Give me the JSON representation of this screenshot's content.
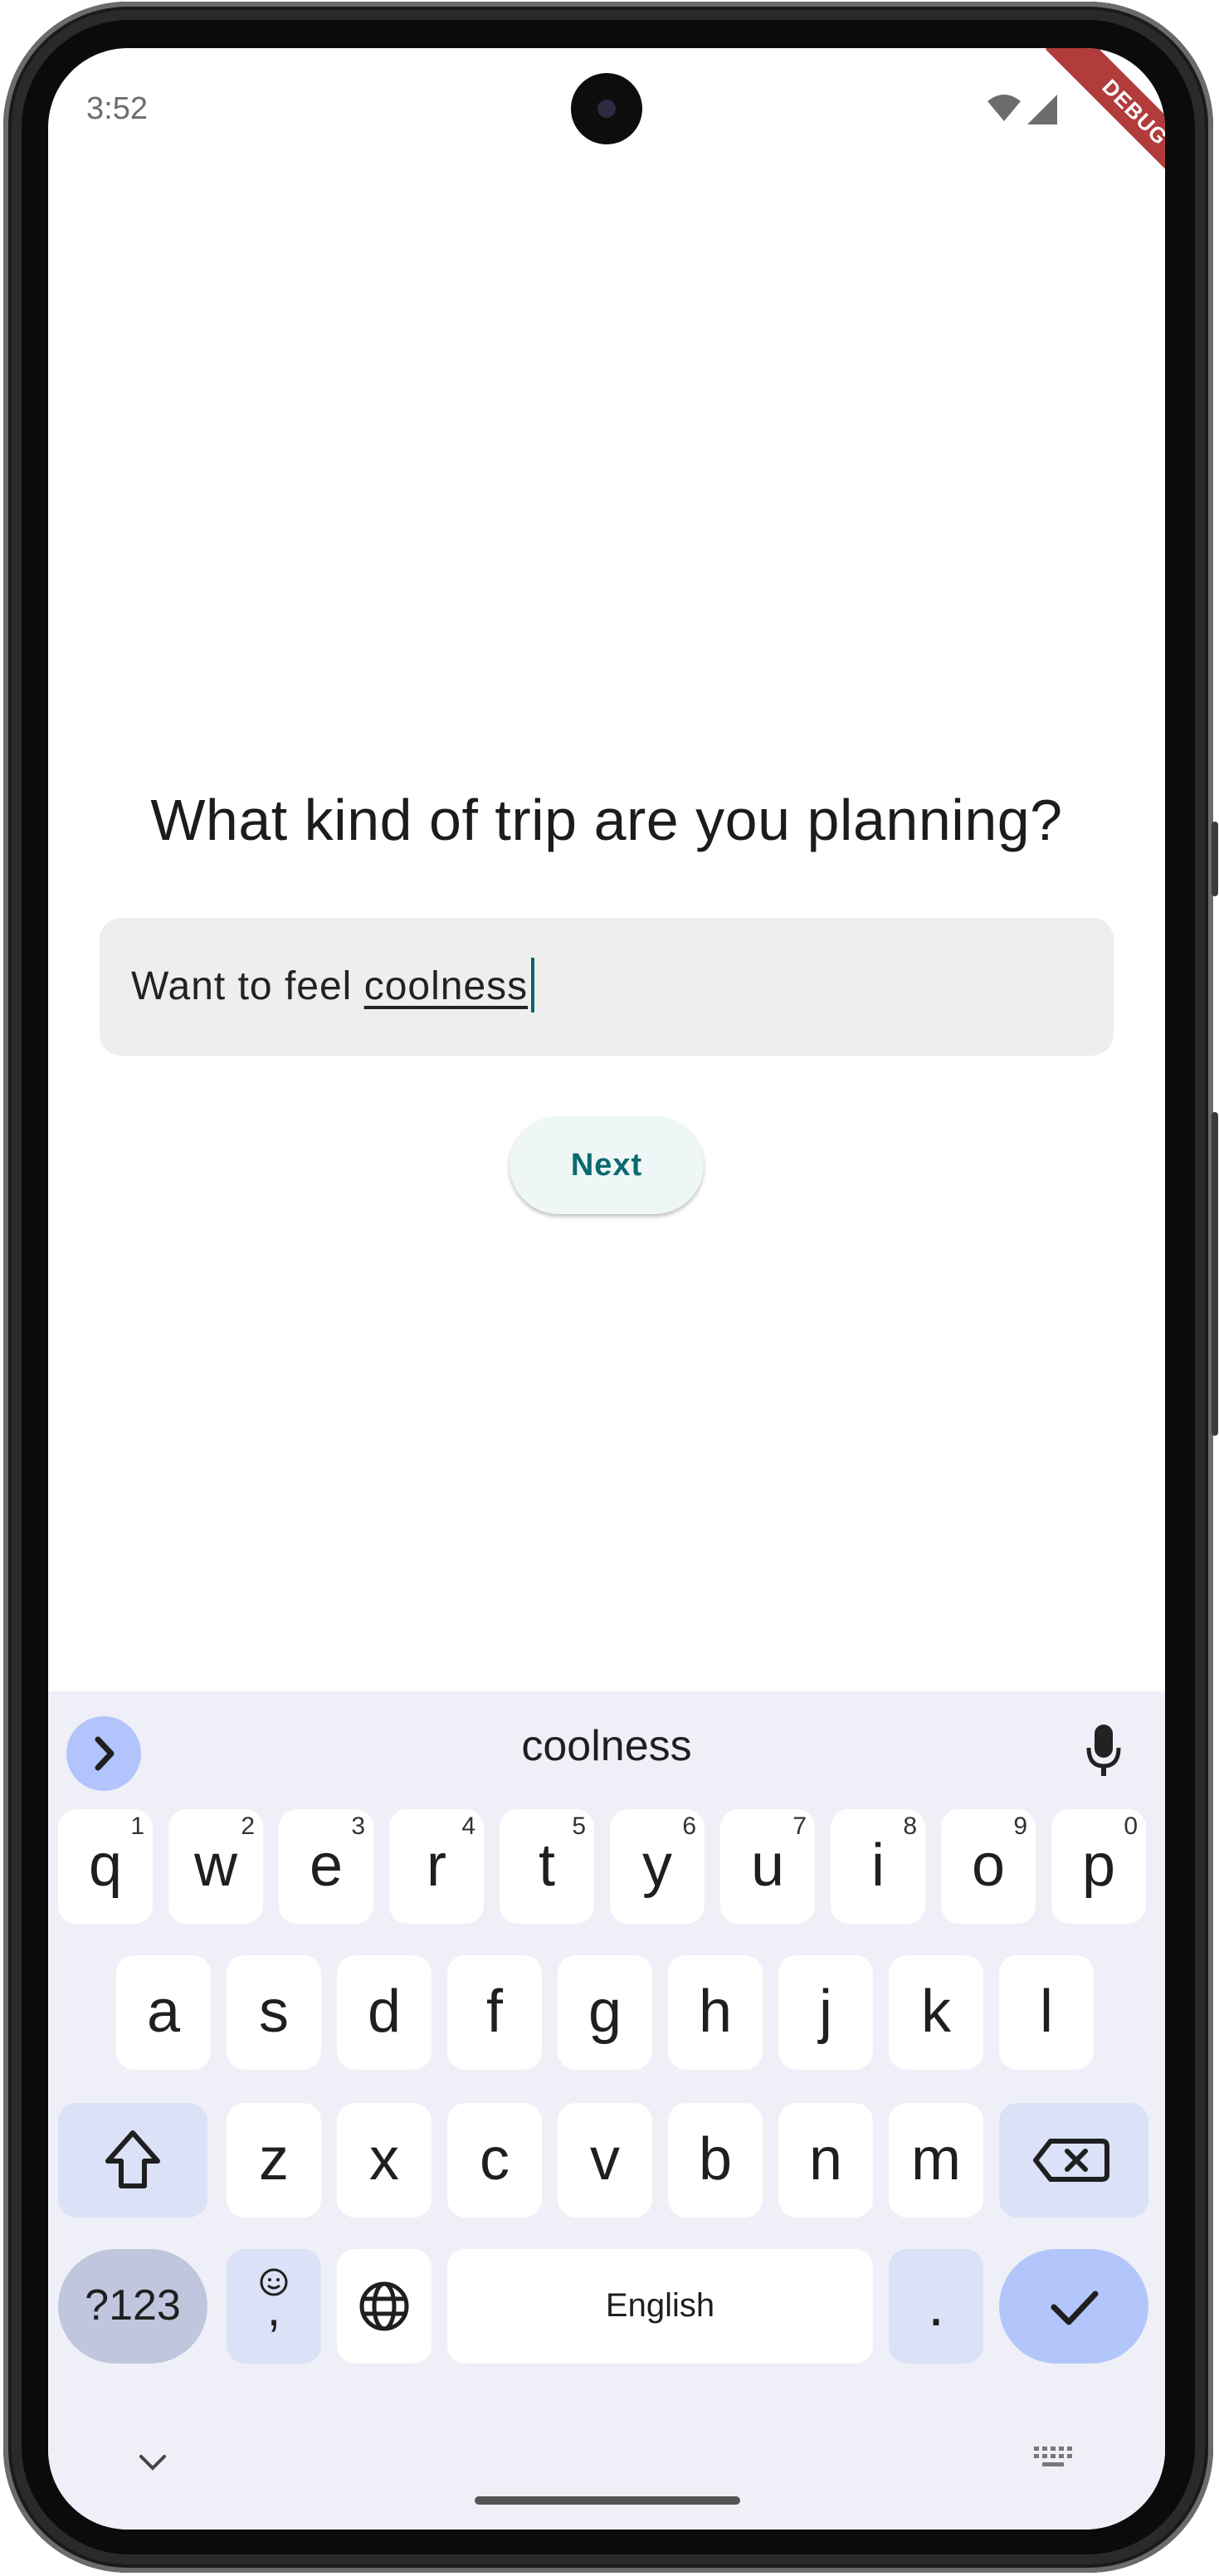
{
  "status_bar": {
    "time": "3:52",
    "debug_label": "DEBUG"
  },
  "page": {
    "question": "What kind of trip are you planning?",
    "input": {
      "prefix": "Want to feel ",
      "composing_word": "coolness"
    },
    "next_label": "Next"
  },
  "keyboard": {
    "suggestion": "coolness",
    "row1": [
      {
        "key": "q",
        "hint": "1"
      },
      {
        "key": "w",
        "hint": "2"
      },
      {
        "key": "e",
        "hint": "3"
      },
      {
        "key": "r",
        "hint": "4"
      },
      {
        "key": "t",
        "hint": "5"
      },
      {
        "key": "y",
        "hint": "6"
      },
      {
        "key": "u",
        "hint": "7"
      },
      {
        "key": "i",
        "hint": "8"
      },
      {
        "key": "o",
        "hint": "9"
      },
      {
        "key": "p",
        "hint": "0"
      }
    ],
    "row2": [
      "a",
      "s",
      "d",
      "f",
      "g",
      "h",
      "j",
      "k",
      "l"
    ],
    "row3": [
      "z",
      "x",
      "c",
      "v",
      "b",
      "n",
      "m"
    ],
    "symbols_label": "?123",
    "comma_label": ",",
    "space_label": "English",
    "period_label": "."
  }
}
